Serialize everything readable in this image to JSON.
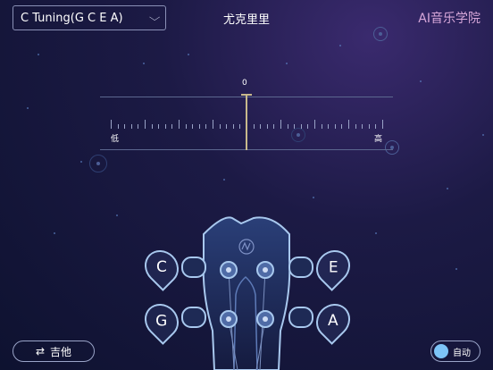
{
  "header": {
    "tuning_select": "C Tuning(G C E A)",
    "title": "尤克里里",
    "brand": "AI音乐学院"
  },
  "meter": {
    "zero_label": "0",
    "low_label": "低",
    "high_label": "高"
  },
  "strings": {
    "top_left": "C",
    "top_right": "E",
    "bottom_left": "G",
    "bottom_right": "A"
  },
  "footer": {
    "instrument_icon": "swap-icon",
    "instrument_button": "吉他",
    "auto_toggle_label": "自动"
  },
  "colors": {
    "accent": "#7dc4f7",
    "brand": "#d7a7d9",
    "needle": "#c8b98c"
  }
}
